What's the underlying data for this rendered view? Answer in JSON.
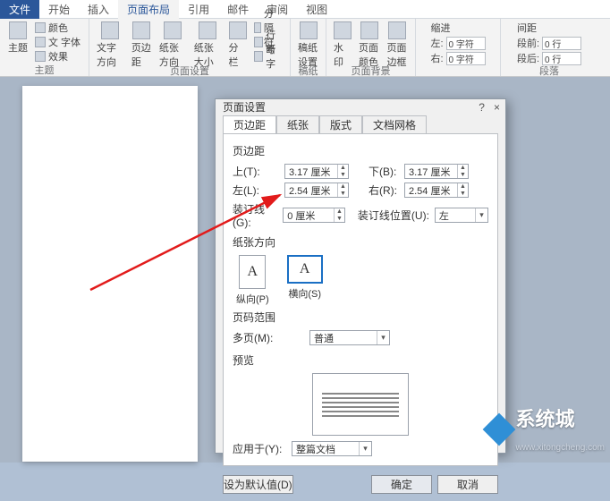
{
  "tabs": {
    "file": "文件",
    "items": [
      "开始",
      "插入",
      "页面布局",
      "引用",
      "邮件",
      "审阅",
      "视图"
    ],
    "active_index": 2
  },
  "ribbon": {
    "group_theme": {
      "label": "主题",
      "theme_btn": "主题",
      "colors": "颜色",
      "fonts": "文 字体",
      "effects": "效果"
    },
    "group_page_setup": {
      "label": "页面设置",
      "text_direction": "文字方向",
      "margins": "页边距",
      "orientation": "纸张方向",
      "size": "纸张大小",
      "columns": "分栏",
      "breaks": "分隔符",
      "line_numbers": "行号",
      "hyphenation": "断字"
    },
    "group_manuscript": {
      "label": "稿纸",
      "manuscript": "稿纸设置"
    },
    "group_page_bg": {
      "label": "页面背景",
      "watermark": "水印",
      "page_color": "页面颜色",
      "page_border": "页面边框"
    },
    "group_indent": {
      "head": "缩进",
      "left": "左:",
      "left_val": "0 字符",
      "right": "右:",
      "right_val": "0 字符"
    },
    "group_spacing": {
      "head": "间距",
      "before": "段前:",
      "before_val": "0 行",
      "after": "段后:",
      "after_val": "0 行",
      "label": "段落"
    }
  },
  "dialog": {
    "title": "页面设置",
    "help": "?",
    "close": "×",
    "tabs": [
      "页边距",
      "纸张",
      "版式",
      "文档网格"
    ],
    "active_tab": 0,
    "margins_section": "页边距",
    "top_label": "上(T):",
    "top_val": "3.17 厘米",
    "bottom_label": "下(B):",
    "bottom_val": "3.17 厘米",
    "left_label": "左(L):",
    "left_val": "2.54 厘米",
    "right_label": "右(R):",
    "right_val": "2.54 厘米",
    "gutter_label": "装订线(G):",
    "gutter_val": "0 厘米",
    "gutter_pos_label": "装订线位置(U):",
    "gutter_pos_val": "左",
    "orientation_section": "纸张方向",
    "portrait": "纵向(P)",
    "landscape": "横向(S)",
    "page_range_section": "页码范围",
    "multi_page_label": "多页(M):",
    "multi_page_val": "普通",
    "preview_section": "预览",
    "apply_label": "应用于(Y):",
    "apply_val": "整篇文档",
    "default_btn": "设为默认值(D)",
    "ok_btn": "确定",
    "cancel_btn": "取消"
  },
  "watermark": {
    "brand": "系统城",
    "url": "www.xitongcheng.com"
  }
}
